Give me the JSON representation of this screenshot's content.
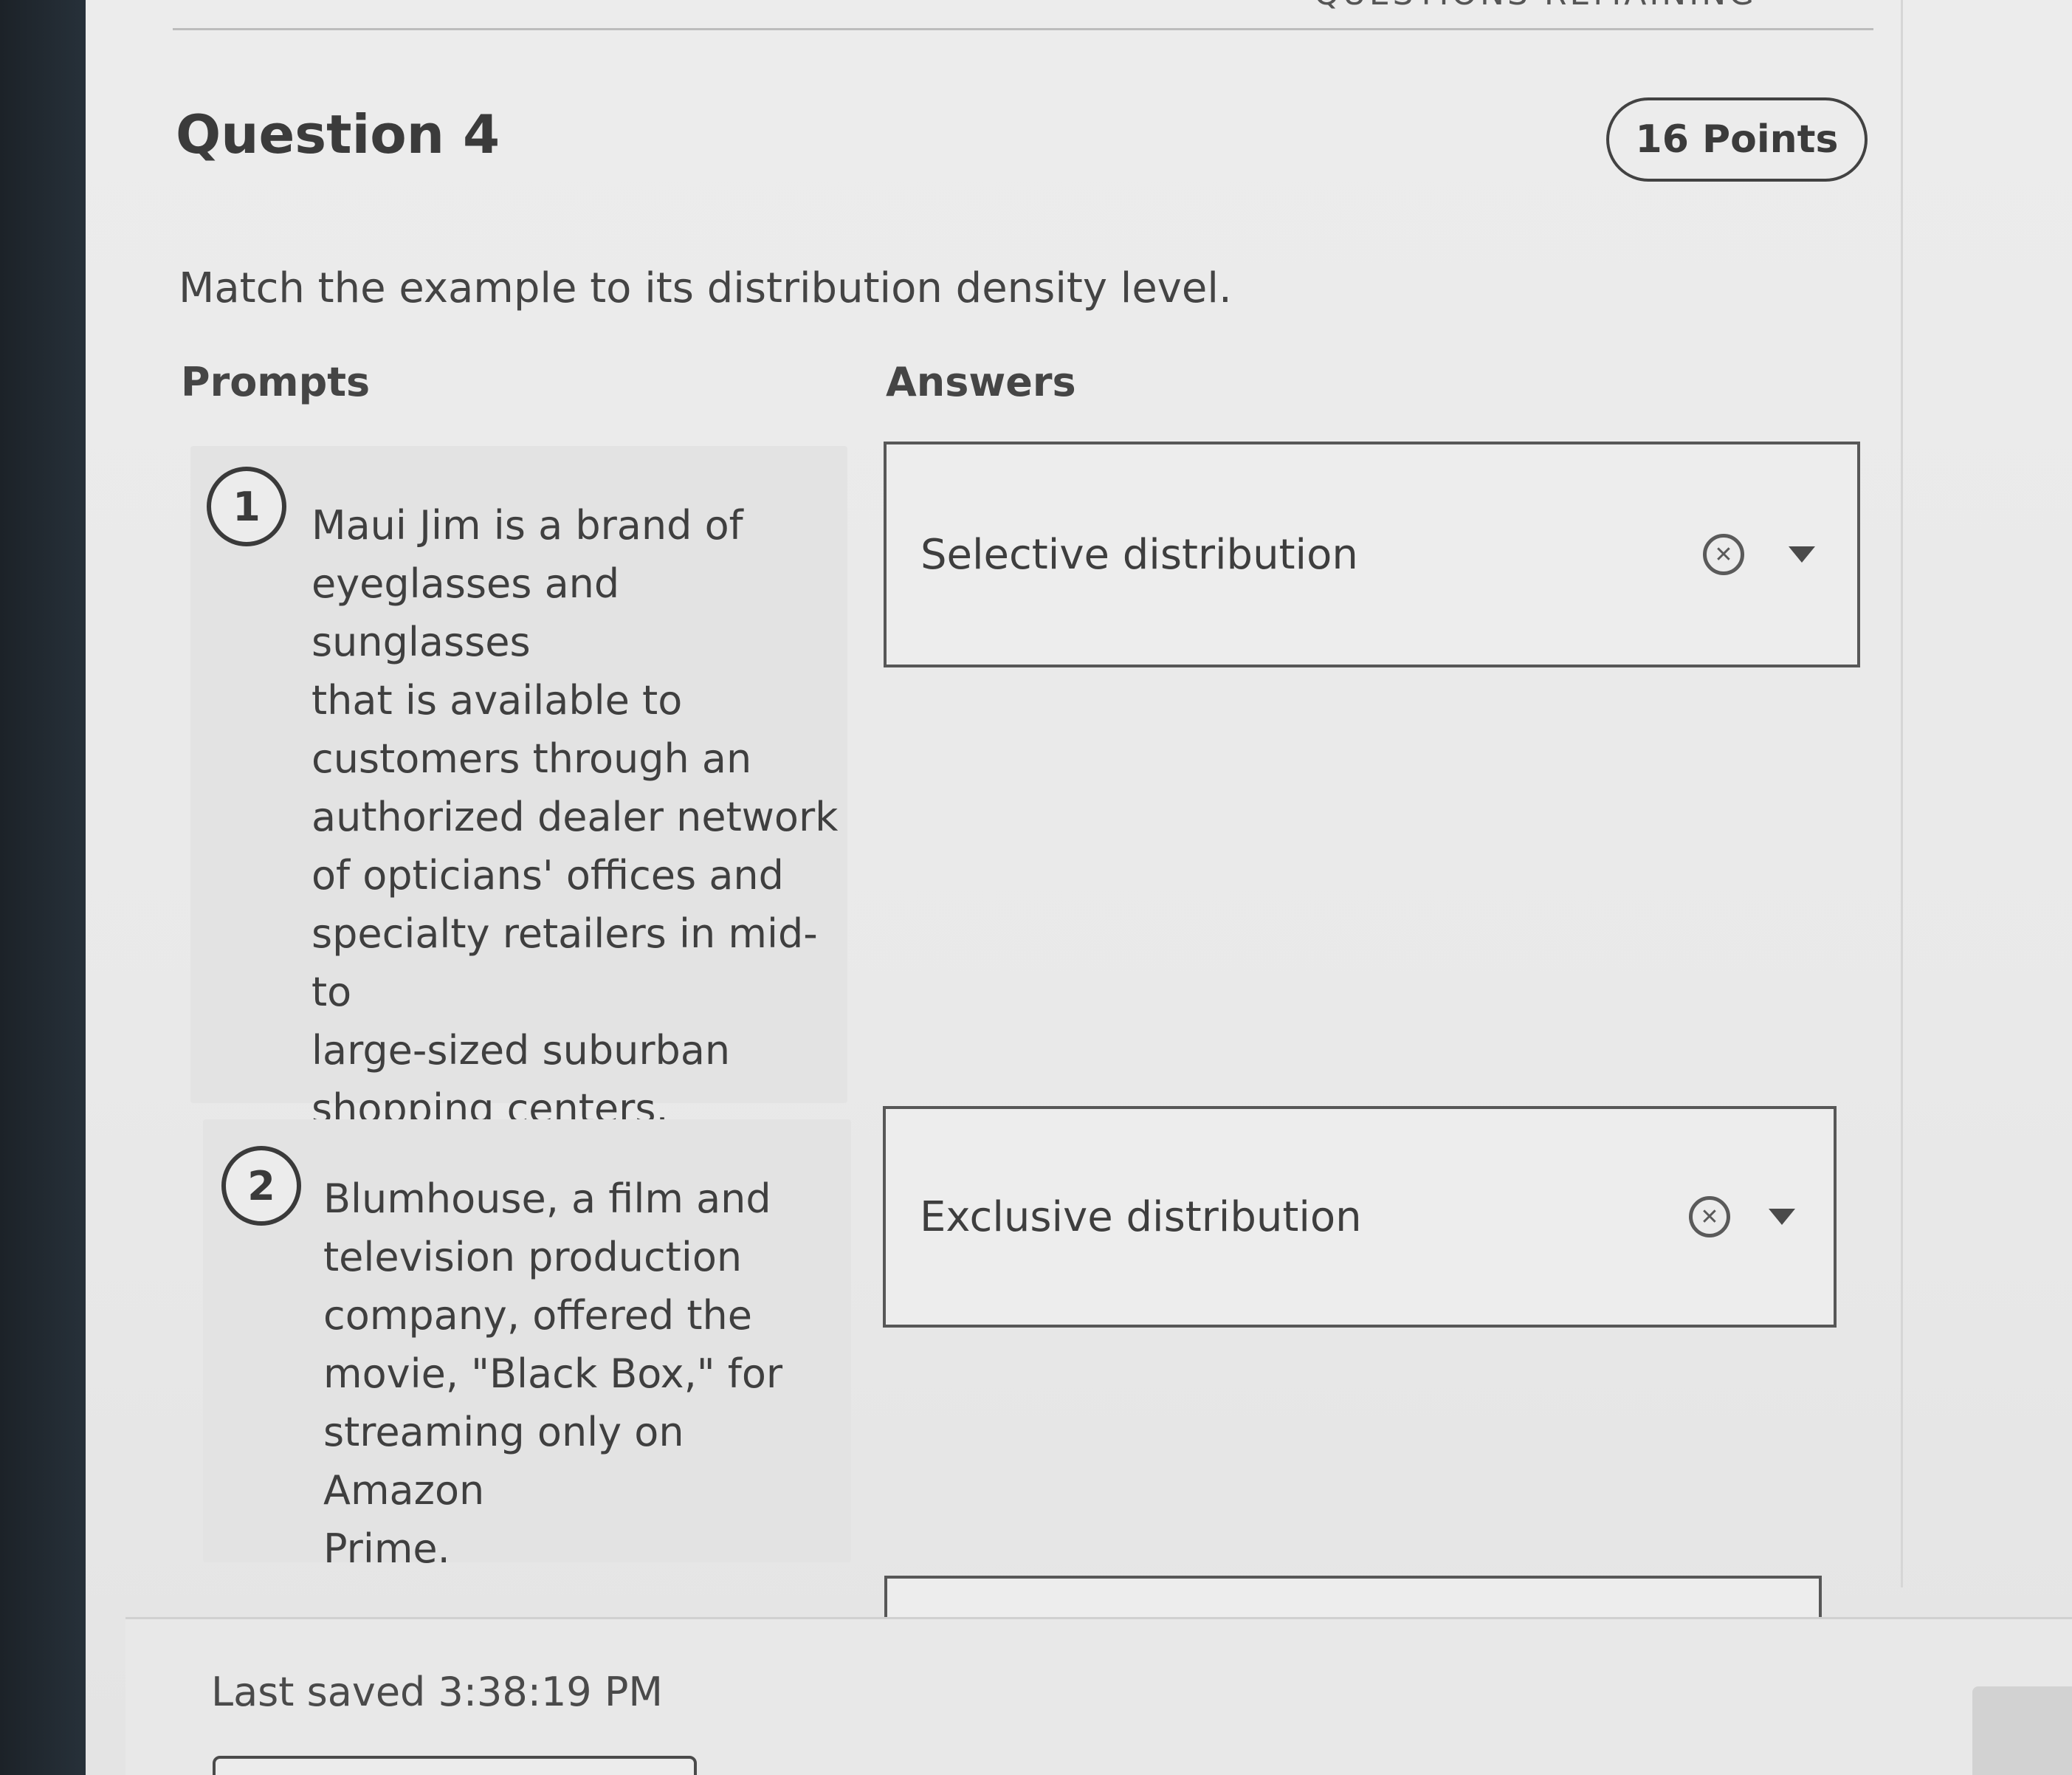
{
  "header": {
    "remaining_text": "QUESTIONS REMAINING"
  },
  "question": {
    "title": "Question 4",
    "points": "16 Points",
    "instruction": "Match the example to its distribution density level."
  },
  "columns": {
    "prompts": "Prompts",
    "answers": "Answers"
  },
  "prompts": [
    {
      "number": "1",
      "text": "Maui Jim is a brand of\neyeglasses and sunglasses\nthat is available to\ncustomers through an\nauthorized dealer network\nof opticians' offices and\nspecialty retailers in mid- to\nlarge-sized suburban\nshopping centers."
    },
    {
      "number": "2",
      "text": "Blumhouse, a film and\ntelevision production\ncompany, offered the\nmovie, \"Black Box,\" for\nstreaming only on Amazon\nPrime."
    }
  ],
  "answers": [
    {
      "value": "Selective distribution",
      "clear_icon": "clear-icon",
      "dropdown_icon": "chevron-down-icon"
    },
    {
      "value": "Exclusive distribution",
      "clear_icon": "clear-icon",
      "dropdown_icon": "chevron-down-icon"
    }
  ],
  "footer": {
    "last_saved": "Last saved 3:38:19 PM"
  }
}
